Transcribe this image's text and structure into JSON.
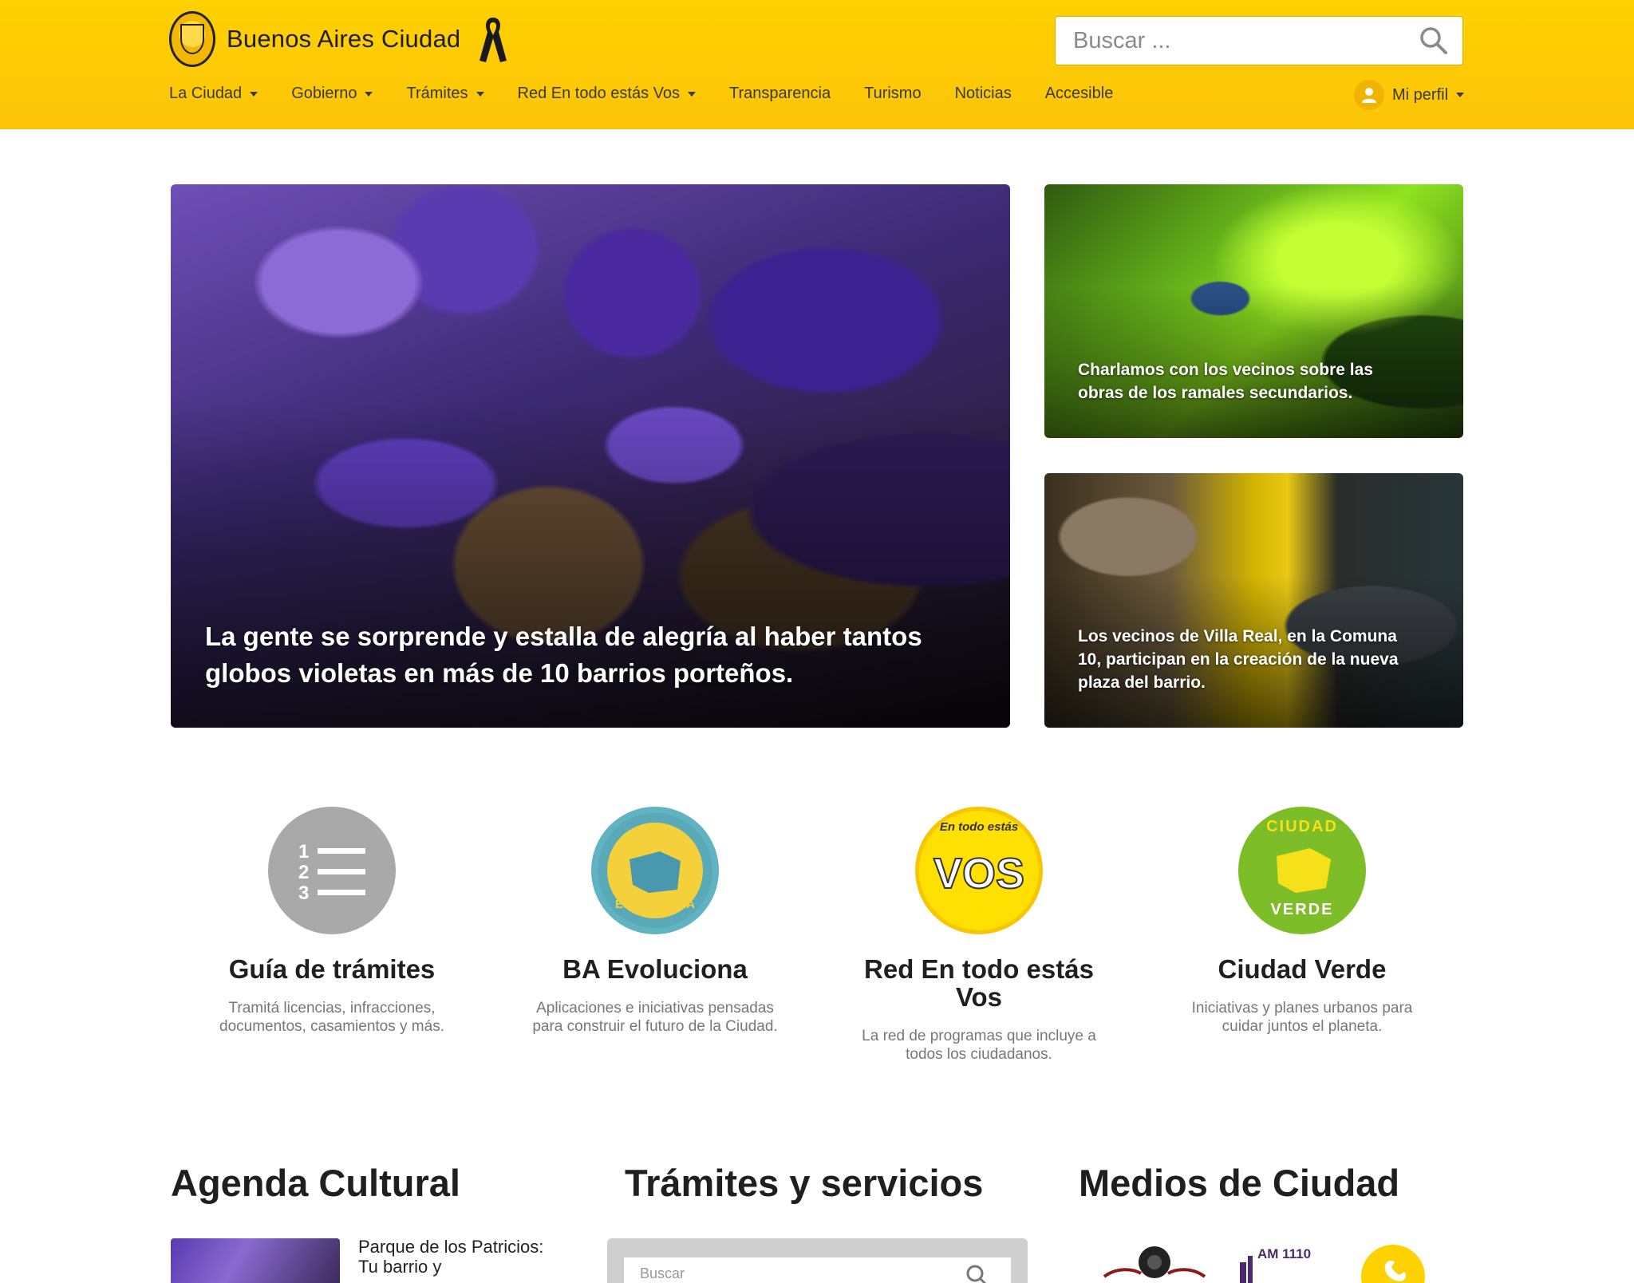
{
  "header": {
    "brand_name": "Buenos Aires Ciudad",
    "search_placeholder": "Buscar ...",
    "nav": [
      {
        "label": "La Ciudad",
        "dropdown": true
      },
      {
        "label": "Gobierno",
        "dropdown": true
      },
      {
        "label": "Trámites",
        "dropdown": true
      },
      {
        "label": "Red En todo estás Vos",
        "dropdown": true
      },
      {
        "label": "Transparencia",
        "dropdown": false
      },
      {
        "label": "Turismo",
        "dropdown": false
      },
      {
        "label": "Noticias",
        "dropdown": false
      },
      {
        "label": "Accesible",
        "dropdown": false
      }
    ],
    "profile_label": "Mi perfil"
  },
  "hero": {
    "main_caption": "La gente se sorprende y estalla de alegría al haber tantos globos violetas en más de 10 barrios porteños.",
    "side1_caption": "Charlamos con los vecinos sobre las obras de los ramales secundarios.",
    "side2_caption": "Los vecinos de Villa Real, en la Comuna 10, participan en la creación de la nueva plaza del barrio."
  },
  "features": [
    {
      "title": "Guía de trámites",
      "description": "Tramitá licencias, infracciones, documentos, casamientos y más.",
      "icon": "numbered-list-icon"
    },
    {
      "title": "BA Evoluciona",
      "description": "Aplicaciones e iniciativas pensadas para construir el futuro de la Ciudad.",
      "icon": "ba-evoluciona-logo",
      "icon_text": "EVOLUCIONA"
    },
    {
      "title": "Red En todo estás Vos",
      "description": "La red de programas que incluye a todos los ciudadanos.",
      "icon": "vos-logo",
      "icon_text": "VOS",
      "icon_subtext": "En todo estás"
    },
    {
      "title": "Ciudad Verde",
      "description": "Iniciativas y planes urbanos para cuidar juntos el planeta.",
      "icon": "ciudad-verde-logo",
      "icon_text": "CIUDAD",
      "icon_subtext": "VERDE"
    }
  ],
  "sections": {
    "agenda_title": "Agenda Cultural",
    "agenda_item": "Parque de los Patricios: Tu barrio y",
    "tramites_title": "Trámites y servicios",
    "tramites_placeholder": "Buscar",
    "medios_title": "Medios de Ciudad",
    "medios": [
      "radio-speaker-logo",
      "am-1110-logo",
      "phone-logo"
    ],
    "medios_am_label": "AM 1110"
  },
  "colors": {
    "header_yellow": "#ffd100",
    "nav_text": "#3a3a3a",
    "accent_green": "#7dbd28",
    "vos_yellow": "#ffe000"
  }
}
